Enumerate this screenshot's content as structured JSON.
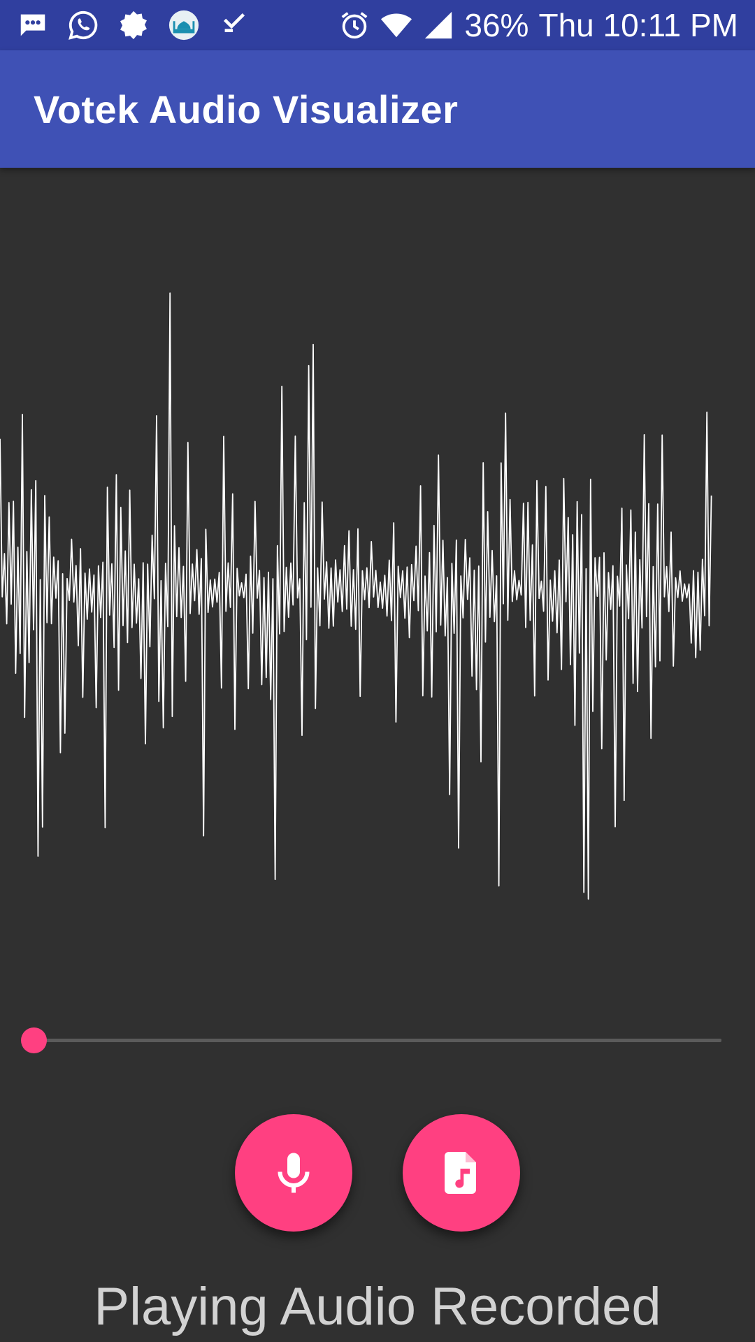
{
  "status_bar": {
    "left_icons": [
      "messages-icon",
      "whatsapp-icon",
      "settings-flower-icon",
      "mosque-app-icon",
      "check-download-icon"
    ],
    "right_icons": [
      "alarm-icon",
      "wifi-icon",
      "cell-signal-icon"
    ],
    "battery": "36%",
    "time": "Thu 10:11 PM"
  },
  "app_bar": {
    "title": "Votek Audio Visualizer"
  },
  "visualizer": {
    "color": "#FFFFFF",
    "background": "#303030"
  },
  "seekbar": {
    "progress": 0.0,
    "accent": "#FF4081"
  },
  "actions": [
    {
      "id": "record",
      "icon": "microphone-icon"
    },
    {
      "id": "open-file",
      "icon": "audio-file-icon"
    }
  ],
  "status_text": "Playing Audio Recorded",
  "colors": {
    "primary": "#3F51B5",
    "primary_dark": "#303F9F",
    "accent": "#FF4081"
  }
}
